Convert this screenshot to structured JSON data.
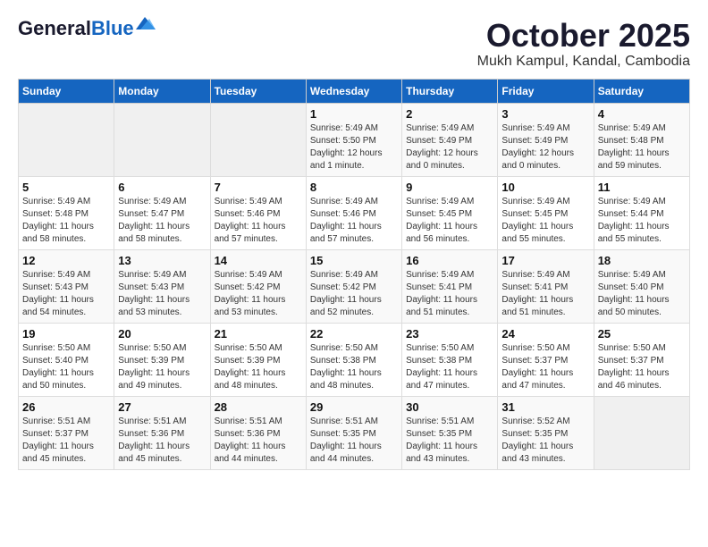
{
  "header": {
    "logo_line1": "General",
    "logo_line2": "Blue",
    "month": "October 2025",
    "location": "Mukh Kampul, Kandal, Cambodia"
  },
  "weekdays": [
    "Sunday",
    "Monday",
    "Tuesday",
    "Wednesday",
    "Thursday",
    "Friday",
    "Saturday"
  ],
  "weeks": [
    [
      {
        "day": "",
        "info": ""
      },
      {
        "day": "",
        "info": ""
      },
      {
        "day": "",
        "info": ""
      },
      {
        "day": "1",
        "info": "Sunrise: 5:49 AM\nSunset: 5:50 PM\nDaylight: 12 hours\nand 1 minute."
      },
      {
        "day": "2",
        "info": "Sunrise: 5:49 AM\nSunset: 5:49 PM\nDaylight: 12 hours\nand 0 minutes."
      },
      {
        "day": "3",
        "info": "Sunrise: 5:49 AM\nSunset: 5:49 PM\nDaylight: 12 hours\nand 0 minutes."
      },
      {
        "day": "4",
        "info": "Sunrise: 5:49 AM\nSunset: 5:48 PM\nDaylight: 11 hours\nand 59 minutes."
      }
    ],
    [
      {
        "day": "5",
        "info": "Sunrise: 5:49 AM\nSunset: 5:48 PM\nDaylight: 11 hours\nand 58 minutes."
      },
      {
        "day": "6",
        "info": "Sunrise: 5:49 AM\nSunset: 5:47 PM\nDaylight: 11 hours\nand 58 minutes."
      },
      {
        "day": "7",
        "info": "Sunrise: 5:49 AM\nSunset: 5:46 PM\nDaylight: 11 hours\nand 57 minutes."
      },
      {
        "day": "8",
        "info": "Sunrise: 5:49 AM\nSunset: 5:46 PM\nDaylight: 11 hours\nand 57 minutes."
      },
      {
        "day": "9",
        "info": "Sunrise: 5:49 AM\nSunset: 5:45 PM\nDaylight: 11 hours\nand 56 minutes."
      },
      {
        "day": "10",
        "info": "Sunrise: 5:49 AM\nSunset: 5:45 PM\nDaylight: 11 hours\nand 55 minutes."
      },
      {
        "day": "11",
        "info": "Sunrise: 5:49 AM\nSunset: 5:44 PM\nDaylight: 11 hours\nand 55 minutes."
      }
    ],
    [
      {
        "day": "12",
        "info": "Sunrise: 5:49 AM\nSunset: 5:43 PM\nDaylight: 11 hours\nand 54 minutes."
      },
      {
        "day": "13",
        "info": "Sunrise: 5:49 AM\nSunset: 5:43 PM\nDaylight: 11 hours\nand 53 minutes."
      },
      {
        "day": "14",
        "info": "Sunrise: 5:49 AM\nSunset: 5:42 PM\nDaylight: 11 hours\nand 53 minutes."
      },
      {
        "day": "15",
        "info": "Sunrise: 5:49 AM\nSunset: 5:42 PM\nDaylight: 11 hours\nand 52 minutes."
      },
      {
        "day": "16",
        "info": "Sunrise: 5:49 AM\nSunset: 5:41 PM\nDaylight: 11 hours\nand 51 minutes."
      },
      {
        "day": "17",
        "info": "Sunrise: 5:49 AM\nSunset: 5:41 PM\nDaylight: 11 hours\nand 51 minutes."
      },
      {
        "day": "18",
        "info": "Sunrise: 5:49 AM\nSunset: 5:40 PM\nDaylight: 11 hours\nand 50 minutes."
      }
    ],
    [
      {
        "day": "19",
        "info": "Sunrise: 5:50 AM\nSunset: 5:40 PM\nDaylight: 11 hours\nand 50 minutes."
      },
      {
        "day": "20",
        "info": "Sunrise: 5:50 AM\nSunset: 5:39 PM\nDaylight: 11 hours\nand 49 minutes."
      },
      {
        "day": "21",
        "info": "Sunrise: 5:50 AM\nSunset: 5:39 PM\nDaylight: 11 hours\nand 48 minutes."
      },
      {
        "day": "22",
        "info": "Sunrise: 5:50 AM\nSunset: 5:38 PM\nDaylight: 11 hours\nand 48 minutes."
      },
      {
        "day": "23",
        "info": "Sunrise: 5:50 AM\nSunset: 5:38 PM\nDaylight: 11 hours\nand 47 minutes."
      },
      {
        "day": "24",
        "info": "Sunrise: 5:50 AM\nSunset: 5:37 PM\nDaylight: 11 hours\nand 47 minutes."
      },
      {
        "day": "25",
        "info": "Sunrise: 5:50 AM\nSunset: 5:37 PM\nDaylight: 11 hours\nand 46 minutes."
      }
    ],
    [
      {
        "day": "26",
        "info": "Sunrise: 5:51 AM\nSunset: 5:37 PM\nDaylight: 11 hours\nand 45 minutes."
      },
      {
        "day": "27",
        "info": "Sunrise: 5:51 AM\nSunset: 5:36 PM\nDaylight: 11 hours\nand 45 minutes."
      },
      {
        "day": "28",
        "info": "Sunrise: 5:51 AM\nSunset: 5:36 PM\nDaylight: 11 hours\nand 44 minutes."
      },
      {
        "day": "29",
        "info": "Sunrise: 5:51 AM\nSunset: 5:35 PM\nDaylight: 11 hours\nand 44 minutes."
      },
      {
        "day": "30",
        "info": "Sunrise: 5:51 AM\nSunset: 5:35 PM\nDaylight: 11 hours\nand 43 minutes."
      },
      {
        "day": "31",
        "info": "Sunrise: 5:52 AM\nSunset: 5:35 PM\nDaylight: 11 hours\nand 43 minutes."
      },
      {
        "day": "",
        "info": ""
      }
    ]
  ]
}
